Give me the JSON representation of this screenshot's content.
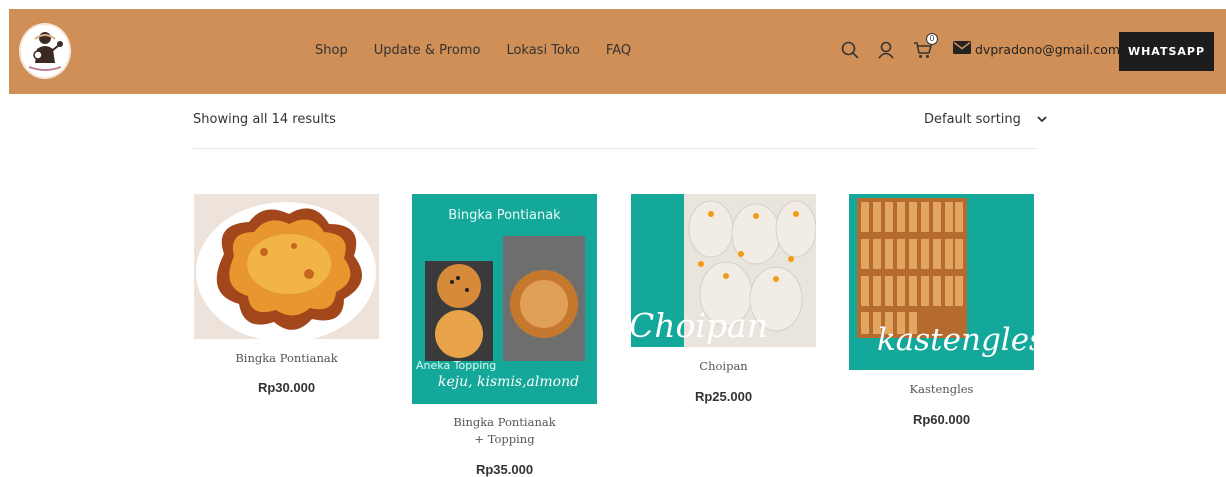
{
  "header": {
    "nav": [
      "Shop",
      "Update & Promo",
      "Lokasi Toko",
      "FAQ"
    ],
    "icons": [
      "search-icon",
      "user-icon",
      "cart-icon",
      "mail-icon"
    ],
    "cart_count": "0",
    "email": "dvpradono@gmail.com",
    "whatsapp_label": "WHATSAPP"
  },
  "toolbar": {
    "result_count": "Showing all 14 results",
    "sorting_selected": "Default sorting"
  },
  "products": [
    {
      "name": "Bingka Pontianak",
      "price": "Rp30.000"
    },
    {
      "name": "Bingka Pontianak + Topping",
      "price": "Rp35.000"
    },
    {
      "name": "Choipan",
      "price": "Rp25.000"
    },
    {
      "name": "Kastengles",
      "price": "Rp60.000"
    }
  ],
  "image_text": {
    "bingka_topping_title": "Bingka Pontianak",
    "bingka_topping_subtitle": "Aneka Topping",
    "bingka_topping_caption": "keju, kismis,almond",
    "choipan_caption": "Choipan",
    "kastengles_caption": "kastengles"
  },
  "colors": {
    "header_bg": "#d08f57",
    "teal": "#14a89a",
    "button_bg": "#1d1d1d"
  }
}
